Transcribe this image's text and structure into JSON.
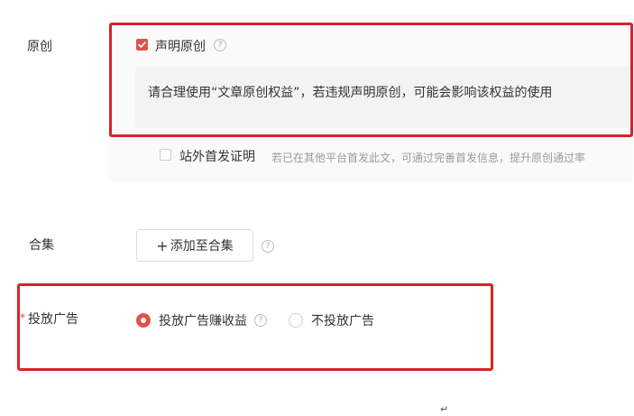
{
  "original": {
    "label": "原创",
    "declare_checkbox_label": "声明原创",
    "declare_checked": true,
    "notice": "请合理使用“文章原创权益”，若违规声明原创，可能会影响该权益的使用",
    "offsite_checkbox_label": "站外首发证明",
    "offsite_checked": false,
    "offsite_hint": "若已在其他平台首发此文，可通过完善首发信息，提升原创通过率",
    "help_glyph": "?"
  },
  "collection": {
    "label": "合集",
    "add_button_plus": "+",
    "add_button_label": "添加至合集",
    "help_glyph": "?"
  },
  "ads": {
    "required_mark": "*",
    "label": "投放广告",
    "options": [
      {
        "label": "投放广告赚收益",
        "selected": true
      },
      {
        "label": "不投放广告",
        "selected": false
      }
    ],
    "help_glyph": "?"
  },
  "icons": {
    "help": "question-circle-icon",
    "check": "checkmark-icon",
    "plus": "plus-icon"
  },
  "colors": {
    "accent": "#e0524a",
    "highlight_border": "#d8232a",
    "hint_text": "#9a9a9a"
  },
  "footer": {
    "return_mark": "↵"
  }
}
